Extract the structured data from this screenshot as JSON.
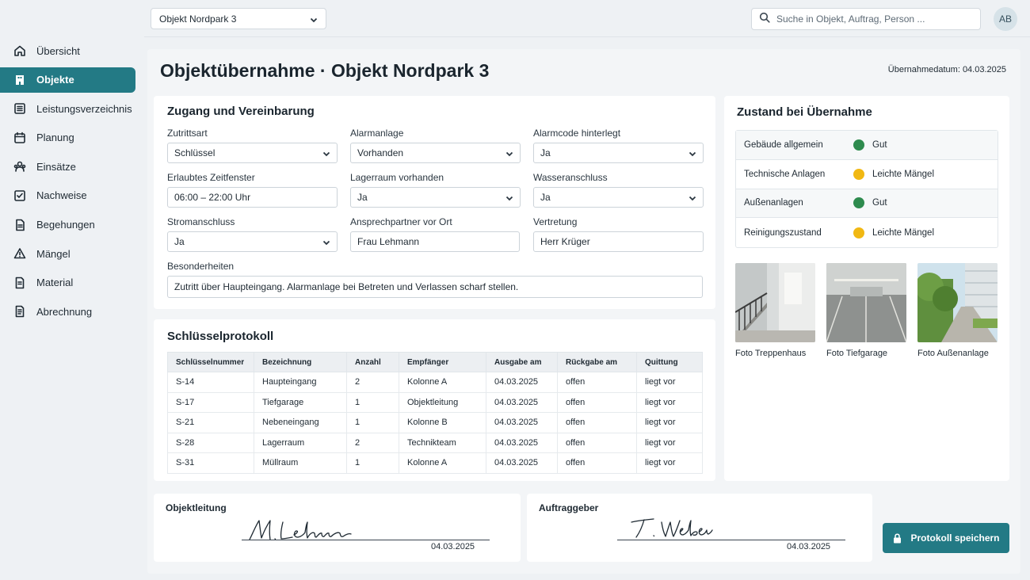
{
  "nav": {
    "items": [
      {
        "label": "Übersicht",
        "icon": "home-icon"
      },
      {
        "label": "Objekte",
        "icon": "building-icon",
        "active": true
      },
      {
        "label": "Leistungsverzeichnis",
        "icon": "list-icon"
      },
      {
        "label": "Planung",
        "icon": "calendar-icon"
      },
      {
        "label": "Einsätze",
        "icon": "team-icon"
      },
      {
        "label": "Nachweise",
        "icon": "checkbox-icon"
      },
      {
        "label": "Begehungen",
        "icon": "clipboard-icon"
      },
      {
        "label": "Mängel",
        "icon": "warning-icon"
      },
      {
        "label": "Material",
        "icon": "document-icon"
      },
      {
        "label": "Abrechnung",
        "icon": "invoice-icon"
      }
    ]
  },
  "topbar": {
    "object_select": "Objekt Nordpark 3",
    "search_placeholder": "Suche in Objekt, Auftrag, Person ...",
    "avatar_initials": "AB"
  },
  "page": {
    "title": "Objektübernahme · Objekt Nordpark 3",
    "date": "Übernahmedatum: 04.03.2025"
  },
  "zugang": {
    "title": "Zugang und Vereinbarung",
    "fields": {
      "zutrittsart": {
        "label": "Zutrittsart",
        "value": "Schlüssel"
      },
      "alarmanlage": {
        "label": "Alarmanlage",
        "value": "Vorhanden"
      },
      "alarmcode": {
        "label": "Alarmcode hinterlegt",
        "value": "Ja"
      },
      "zeitfenster": {
        "label": "Erlaubtes Zeitfenster",
        "value": "06:00 – 22:00 Uhr"
      },
      "lagerraum": {
        "label": "Lagerraum vorhanden",
        "value": "Ja"
      },
      "wasser": {
        "label": "Wasseranschluss",
        "value": "Ja"
      },
      "strom": {
        "label": "Stromanschluss",
        "value": "Ja"
      },
      "ansprechpartner": {
        "label": "Ansprechpartner vor Ort",
        "value": "Frau Lehmann"
      },
      "vertretung": {
        "label": "Vertretung",
        "value": "Herr Krüger"
      },
      "besonderheiten": {
        "label": "Besonderheiten",
        "value": "Zutritt über Haupteingang. Alarmanlage bei Betreten und Verlassen scharf stellen."
      }
    }
  },
  "zustand": {
    "title": "Zustand bei Übernahme",
    "rows": [
      {
        "name": "Gebäude allgemein",
        "status": "Gut",
        "color": "#2e8b4e"
      },
      {
        "name": "Technische Anlagen",
        "status": "Leichte Mängel",
        "color": "#f1b813"
      },
      {
        "name": "Außenanlagen",
        "status": "Gut",
        "color": "#2e8b4e"
      },
      {
        "name": "Reinigungszustand",
        "status": "Leichte Mängel",
        "color": "#f1b813"
      }
    ],
    "photos": [
      {
        "caption": "Foto Treppenhaus"
      },
      {
        "caption": "Foto Tiefgarage"
      },
      {
        "caption": "Foto Außenanlage"
      }
    ]
  },
  "keys": {
    "title": "Schlüsselprotokoll",
    "columns": [
      "Schlüsselnummer",
      "Bezeichnung",
      "Anzahl",
      "Empfänger",
      "Ausgabe am",
      "Rückgabe am",
      "Quittung"
    ],
    "rows": [
      [
        "S-14",
        "Haupteingang",
        "2",
        "Kolonne A",
        "04.03.2025",
        "offen",
        "liegt vor"
      ],
      [
        "S-17",
        "Tiefgarage",
        "1",
        "Objektleitung",
        "04.03.2025",
        "offen",
        "liegt vor"
      ],
      [
        "S-21",
        "Nebeneingang",
        "1",
        "Kolonne B",
        "04.03.2025",
        "offen",
        "liegt vor"
      ],
      [
        "S-28",
        "Lagerraum",
        "2",
        "Technikteam",
        "04.03.2025",
        "offen",
        "liegt vor"
      ],
      [
        "S-31",
        "Müllraum",
        "1",
        "Kolonne A",
        "04.03.2025",
        "offen",
        "liegt vor"
      ]
    ]
  },
  "signatures": {
    "objektleitung": {
      "title": "Objektleitung",
      "signature": "M. Lehmann",
      "date": "04.03.2025"
    },
    "auftraggeber": {
      "title": "Auftraggeber",
      "signature": "T. Weber",
      "date": "04.03.2025"
    }
  },
  "actions": {
    "save_label": "Protokoll speichern"
  },
  "colors": {
    "accent": "#237a85",
    "good": "#2e8b4e",
    "warning": "#f1b813"
  }
}
